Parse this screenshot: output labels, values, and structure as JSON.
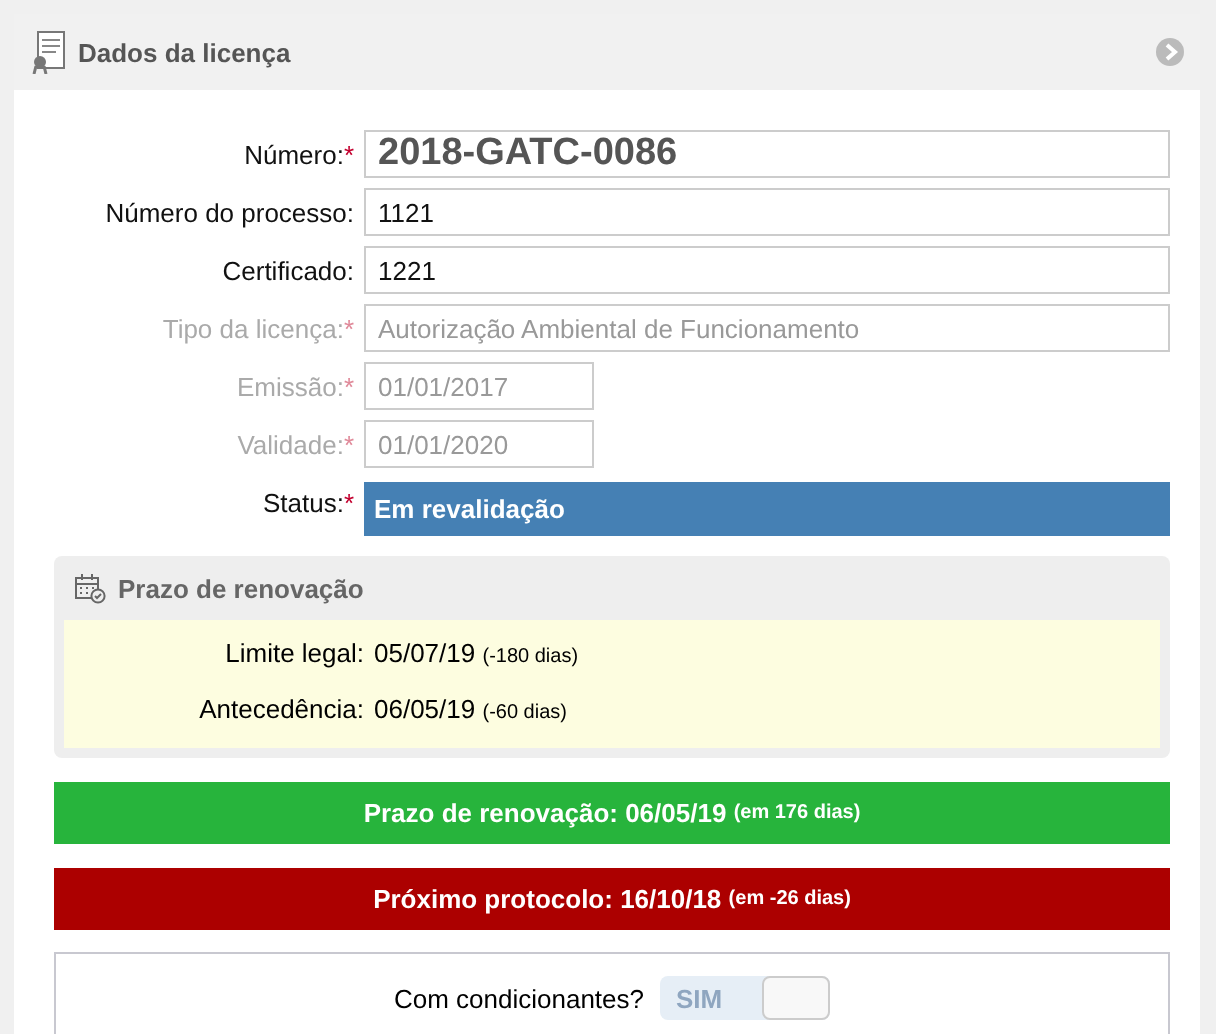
{
  "panel": {
    "title": "Dados da licença"
  },
  "fields": [
    {
      "kind": "title",
      "label": "Número:",
      "marker": "*",
      "disabled": false,
      "value": "2018-GATC-0086"
    },
    {
      "kind": "text",
      "label": "Número do processo:",
      "disabled": false,
      "value": "1121"
    },
    {
      "kind": "text",
      "label": "Certificado:",
      "disabled": false,
      "value": "1221"
    },
    {
      "kind": "text",
      "label": "Tipo da licença:",
      "marker": "*",
      "disabled": true,
      "value": "Autorização Ambiental de Funcionamento"
    },
    {
      "kind": "date",
      "label": "Emissão:",
      "marker": "*",
      "disabled": true,
      "value": "01/01/2017"
    },
    {
      "kind": "date",
      "label": "Validade:",
      "marker": "*",
      "disabled": true,
      "value": "01/01/2020"
    },
    {
      "kind": "status",
      "label": "Status:",
      "marker": "*",
      "value": "Em revalidação"
    }
  ],
  "renewal": {
    "title": "Prazo de renovação",
    "rows": [
      {
        "label": "Limite legal:",
        "date": "05/07/19",
        "note": "(-180 dias)"
      },
      {
        "label": "Antecedência:",
        "date": "06/05/19",
        "note": "(-60 dias)"
      }
    ]
  },
  "alerts": [
    {
      "text": "Prazo de renovação: 06/05/19",
      "note": "(em 176 dias)",
      "color": "#27b43c"
    },
    {
      "text": "Próximo protocolo: 16/10/18",
      "note": "(em -26 dias)",
      "color": "#ac0000"
    }
  ],
  "conditions": {
    "label": "Com condicionantes?",
    "toggle": "SIM",
    "on": false
  }
}
